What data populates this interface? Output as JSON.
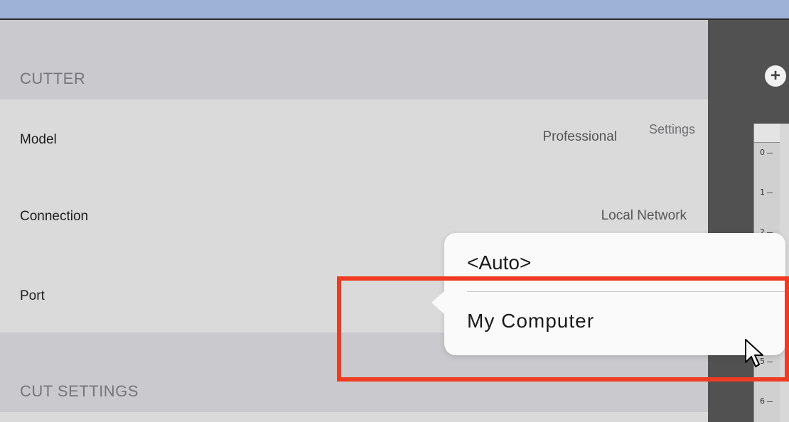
{
  "cutter_section": {
    "header": "CUTTER"
  },
  "fields": [
    {
      "label": "Model",
      "value": "Professional",
      "action": "Settings"
    },
    {
      "label": "Connection",
      "value": "Local Network"
    },
    {
      "label": "Port"
    }
  ],
  "cut_settings_section": {
    "header": "CUT SETTINGS"
  },
  "sidebar": {
    "add_icon": "plus-circle-icon",
    "ruler_ticks": [
      "0",
      "1",
      "2",
      "5",
      "6"
    ]
  },
  "port_dropdown": {
    "options": [
      "<Auto>",
      "My Computer"
    ],
    "highlighted": "My Computer"
  },
  "highlight_color": "#ee3b22",
  "cursor_icon": "mouse-pointer-icon"
}
